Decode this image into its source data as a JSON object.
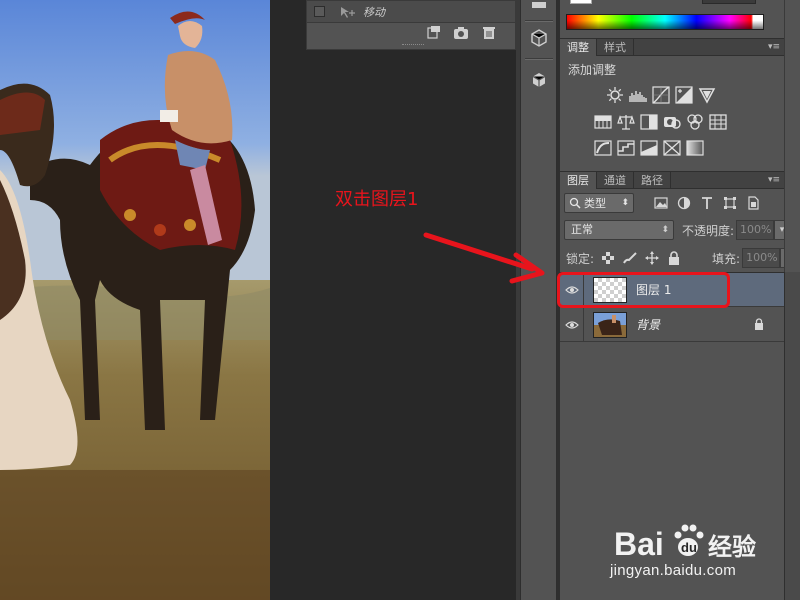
{
  "history": {
    "item_label": "移动"
  },
  "adjustments": {
    "tab_adjust": "调整",
    "tab_styles": "样式",
    "title": "添加调整"
  },
  "layers": {
    "tab_layers": "图层",
    "tab_channels": "通道",
    "tab_paths": "路径",
    "kind_filter": "类型",
    "blend_mode": "正常",
    "opacity_label": "不透明度:",
    "opacity_value": "100%",
    "lock_label": "锁定:",
    "fill_label": "填充:",
    "fill_value": "100%",
    "items": [
      {
        "name": "图层 1",
        "visible": true,
        "selected": true
      },
      {
        "name": "背景",
        "visible": true,
        "selected": false,
        "locked": true
      }
    ]
  },
  "annotation": {
    "text": "双击图层1",
    "color": "#e8141c"
  },
  "watermark": {
    "brand": "Bai",
    "brand_tail": "经验",
    "url": "jingyan.baidu.com"
  },
  "colors": {
    "panel_bg": "#535353",
    "selected_row": "#5e6a7c",
    "highlight": "#e8141c"
  }
}
